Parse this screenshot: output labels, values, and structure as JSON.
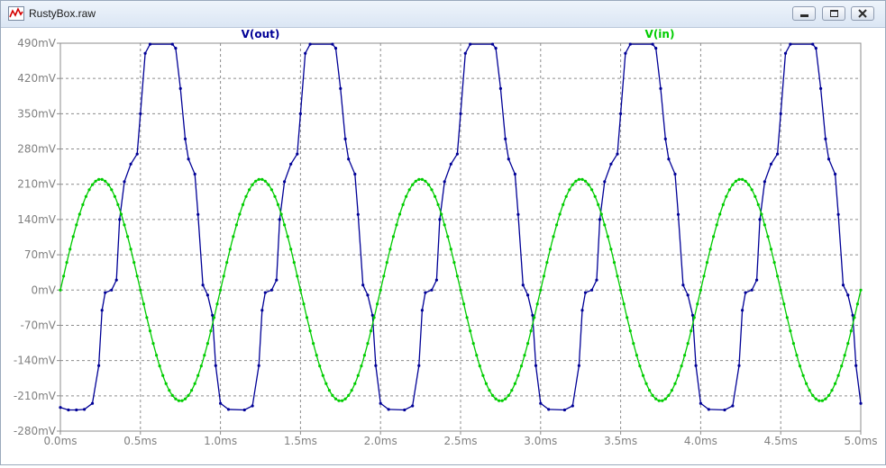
{
  "window": {
    "title": "RustyBox.raw",
    "controls": [
      "minimize",
      "maximize",
      "close"
    ]
  },
  "chart_data": {
    "type": "line",
    "title": "",
    "xlabel": "",
    "ylabel": "",
    "xlim": [
      0,
      5
    ],
    "ylim": [
      -280,
      490
    ],
    "x_unit": "ms",
    "y_unit": "mV",
    "grid": true,
    "x_ticks": [
      "0.0ms",
      "0.5ms",
      "1.0ms",
      "1.5ms",
      "2.0ms",
      "2.5ms",
      "3.0ms",
      "3.5ms",
      "4.0ms",
      "4.5ms",
      "5.0ms"
    ],
    "y_ticks": [
      "490mV",
      "420mV",
      "350mV",
      "280mV",
      "210mV",
      "140mV",
      "70mV",
      "0mV",
      "-70mV",
      "-140mV",
      "-210mV",
      "-280mV"
    ],
    "series": [
      {
        "name": "V(out)",
        "color": "#000096",
        "points": [
          [
            0.0,
            -233
          ],
          [
            0.05,
            -238
          ],
          [
            0.1,
            -238
          ],
          [
            0.15,
            -237
          ],
          [
            0.2,
            -225
          ],
          [
            0.24,
            -150
          ],
          [
            0.26,
            -40
          ],
          [
            0.28,
            -5
          ],
          [
            0.32,
            0
          ],
          [
            0.35,
            20
          ],
          [
            0.37,
            140
          ],
          [
            0.4,
            215
          ],
          [
            0.44,
            250
          ],
          [
            0.48,
            270
          ],
          [
            0.5,
            350
          ],
          [
            0.53,
            470
          ],
          [
            0.56,
            488
          ],
          [
            0.7,
            488
          ],
          [
            0.72,
            480
          ],
          [
            0.75,
            400
          ],
          [
            0.78,
            300
          ],
          [
            0.8,
            260
          ],
          [
            0.84,
            230
          ],
          [
            0.86,
            150
          ],
          [
            0.89,
            10
          ],
          [
            0.92,
            -10
          ],
          [
            0.95,
            -50
          ],
          [
            0.97,
            -150
          ],
          [
            1.0,
            -225
          ],
          [
            1.05,
            -237
          ],
          [
            1.15,
            -238
          ],
          [
            1.2,
            -230
          ],
          [
            1.24,
            -150
          ],
          [
            1.26,
            -40
          ],
          [
            1.28,
            -5
          ],
          [
            1.32,
            0
          ],
          [
            1.35,
            20
          ],
          [
            1.37,
            140
          ],
          [
            1.4,
            215
          ],
          [
            1.44,
            250
          ],
          [
            1.48,
            270
          ],
          [
            1.5,
            350
          ],
          [
            1.53,
            470
          ],
          [
            1.56,
            488
          ],
          [
            1.7,
            488
          ],
          [
            1.72,
            480
          ],
          [
            1.75,
            400
          ],
          [
            1.78,
            300
          ],
          [
            1.8,
            260
          ],
          [
            1.84,
            230
          ],
          [
            1.86,
            150
          ],
          [
            1.89,
            10
          ],
          [
            1.92,
            -10
          ],
          [
            1.95,
            -50
          ],
          [
            1.97,
            -150
          ],
          [
            2.0,
            -225
          ],
          [
            2.05,
            -237
          ],
          [
            2.15,
            -238
          ],
          [
            2.2,
            -230
          ],
          [
            2.24,
            -150
          ],
          [
            2.26,
            -40
          ],
          [
            2.28,
            -5
          ],
          [
            2.32,
            0
          ],
          [
            2.35,
            20
          ],
          [
            2.37,
            140
          ],
          [
            2.4,
            215
          ],
          [
            2.44,
            250
          ],
          [
            2.48,
            270
          ],
          [
            2.5,
            350
          ],
          [
            2.53,
            470
          ],
          [
            2.56,
            488
          ],
          [
            2.7,
            488
          ],
          [
            2.72,
            480
          ],
          [
            2.75,
            400
          ],
          [
            2.78,
            300
          ],
          [
            2.8,
            260
          ],
          [
            2.84,
            230
          ],
          [
            2.86,
            150
          ],
          [
            2.89,
            10
          ],
          [
            2.92,
            -10
          ],
          [
            2.95,
            -50
          ],
          [
            2.97,
            -150
          ],
          [
            3.0,
            -225
          ],
          [
            3.05,
            -237
          ],
          [
            3.15,
            -238
          ],
          [
            3.2,
            -230
          ],
          [
            3.24,
            -150
          ],
          [
            3.26,
            -40
          ],
          [
            3.28,
            -5
          ],
          [
            3.32,
            0
          ],
          [
            3.35,
            20
          ],
          [
            3.37,
            140
          ],
          [
            3.4,
            215
          ],
          [
            3.44,
            250
          ],
          [
            3.48,
            270
          ],
          [
            3.5,
            350
          ],
          [
            3.53,
            470
          ],
          [
            3.56,
            488
          ],
          [
            3.7,
            488
          ],
          [
            3.72,
            480
          ],
          [
            3.75,
            400
          ],
          [
            3.78,
            300
          ],
          [
            3.8,
            260
          ],
          [
            3.84,
            230
          ],
          [
            3.86,
            150
          ],
          [
            3.89,
            10
          ],
          [
            3.92,
            -10
          ],
          [
            3.95,
            -50
          ],
          [
            3.97,
            -150
          ],
          [
            4.0,
            -225
          ],
          [
            4.05,
            -237
          ],
          [
            4.15,
            -238
          ],
          [
            4.2,
            -230
          ],
          [
            4.24,
            -150
          ],
          [
            4.26,
            -40
          ],
          [
            4.28,
            -5
          ],
          [
            4.32,
            0
          ],
          [
            4.35,
            20
          ],
          [
            4.37,
            140
          ],
          [
            4.4,
            215
          ],
          [
            4.44,
            250
          ],
          [
            4.48,
            270
          ],
          [
            4.5,
            350
          ],
          [
            4.53,
            470
          ],
          [
            4.56,
            488
          ],
          [
            4.7,
            488
          ],
          [
            4.72,
            480
          ],
          [
            4.75,
            400
          ],
          [
            4.78,
            300
          ],
          [
            4.8,
            260
          ],
          [
            4.84,
            230
          ],
          [
            4.86,
            150
          ],
          [
            4.89,
            10
          ],
          [
            4.92,
            -10
          ],
          [
            4.95,
            -50
          ],
          [
            4.97,
            -150
          ],
          [
            5.0,
            -225
          ]
        ]
      },
      {
        "name": "V(in)",
        "color": "#00cc00",
        "function": "sine",
        "amplitude_mV": 220,
        "frequency_kHz": 1,
        "phase_deg": 0
      }
    ]
  }
}
